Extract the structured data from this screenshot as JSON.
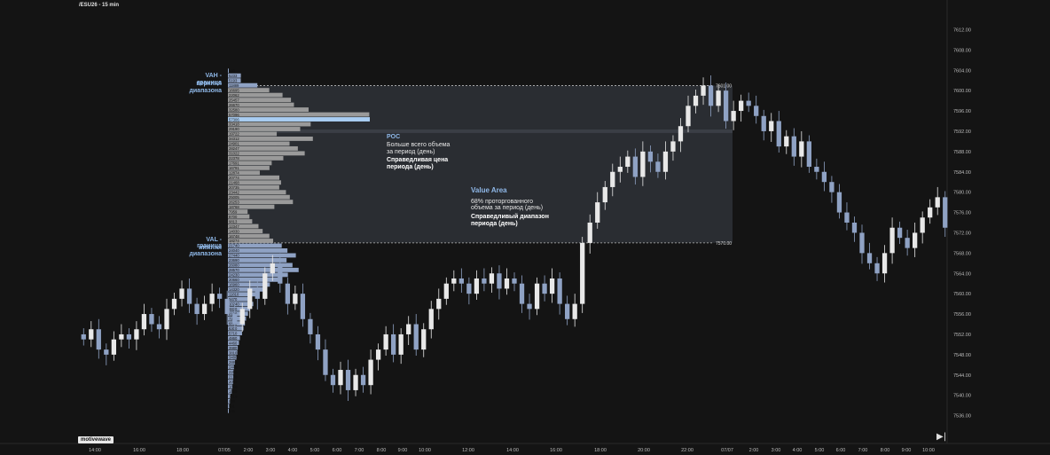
{
  "header": {
    "symbol": "/ESU26 - 15 min"
  },
  "branding": {
    "logo_text": "motivewave"
  },
  "controls": {
    "play_icon_glyph": "▶|"
  },
  "colors": {
    "background": "#141414",
    "up_candle": "#e8e8e8",
    "down_candle": "#8fa2c4",
    "profile_gray": "#9a9a9a",
    "profile_blue": "#8fa2c4",
    "poc_highlight": "#a9cdf2",
    "value_area": "#2a2d32",
    "accent_text": "#8fb8e8"
  },
  "annotations": {
    "vah_line1": "VAH - верхняя",
    "vah_line2": "граница диапазона",
    "val_line1": "VAL - нижняя",
    "val_line2": "граница диапазона",
    "poc_title": "POC",
    "poc_desc1": "Больше всего объема",
    "poc_desc2": "за период (день)",
    "poc_bold1": "Справедливая цена",
    "poc_bold2": "периода (день)",
    "va_title": "Value Area",
    "va_desc1": "68% проторгованного",
    "va_desc2": "объема за период (день)",
    "va_bold1": "Справедливый диапазон",
    "va_bold2": "периода (день)"
  },
  "chart_data": {
    "type": "candlestick",
    "title": "/ESU26 - 15 min",
    "ylim": [
      7534,
      7614
    ],
    "y_ticks": [
      7612,
      7608,
      7604,
      7600,
      7596,
      7592,
      7588,
      7584,
      7580,
      7576,
      7572,
      7568,
      7564,
      7560,
      7556,
      7552,
      7548,
      7544,
      7540,
      7536
    ],
    "y_tick_labels": [
      "7612.00",
      "7608.00",
      "7604.00",
      "7600.00",
      "7596.00",
      "7592.00",
      "7588.00",
      "7584.00",
      "7580.00",
      "7576.00",
      "7572.00",
      "7568.00",
      "7564.00",
      "7560.00",
      "7556.00",
      "7552.00",
      "7548.00",
      "7544.00",
      "7540.00",
      "7536.00"
    ],
    "x_tick_labels": [
      "14:00",
      "16:00",
      "18:00",
      "07/05",
      "2:00",
      "3:00",
      "4:00",
      "5:00",
      "6:00",
      "7:00",
      "8:00",
      "9:00",
      "10:00",
      "12:00",
      "14:00",
      "16:00",
      "18:00",
      "20:00",
      "22:00",
      "07/07",
      "2:00",
      "3:00",
      "4:00",
      "5:00",
      "6:00",
      "7:00",
      "8:00",
      "9:00",
      "10:00"
    ],
    "value_area": {
      "vah": 7601,
      "val": 7570,
      "poc": 7592,
      "vah_label": "7601.00",
      "val_label": "7570.00"
    },
    "closes": [
      7551,
      7553,
      7549,
      7548,
      7551,
      7552,
      7551,
      7553,
      7556,
      7554,
      7553,
      7557,
      7559,
      7561,
      7558,
      7556,
      7558,
      7560,
      7559,
      7556,
      7554,
      7557,
      7561,
      7559,
      7564,
      7566,
      7562,
      7558,
      7560,
      7555,
      7552,
      7549,
      7544,
      7542,
      7545,
      7541,
      7544,
      7542,
      7547,
      7549,
      7552,
      7548,
      7552,
      7554,
      7549,
      7553,
      7557,
      7559,
      7562,
      7563,
      7562,
      7560,
      7563,
      7562,
      7564,
      7561,
      7563,
      7562,
      7558,
      7557,
      7562,
      7560,
      7563,
      7558,
      7555,
      7558,
      7570,
      7574,
      7578,
      7581,
      7584,
      7585,
      7587,
      7583,
      7588,
      7586,
      7584,
      7588,
      7590,
      7593,
      7597,
      7599,
      7601,
      7597,
      7600,
      7594,
      7596,
      7598,
      7597,
      7595,
      7592,
      7594,
      7589,
      7591,
      7587,
      7590,
      7585,
      7584,
      7582,
      7580,
      7576,
      7574,
      7572,
      7568,
      7566,
      7564,
      7568,
      7573,
      7571,
      7569,
      7572,
      7575,
      7577,
      7579,
      7573
    ],
    "profile_volumes": [
      130,
      5233,
      5193,
      11889,
      16695,
      22062,
      25457,
      26670,
      32580,
      57096,
      57306,
      33418,
      29190,
      19722,
      34312,
      24901,
      28247,
      31022,
      22378,
      17691,
      16791,
      12874,
      20774,
      21468,
      20735,
      23442,
      25005,
      26253,
      18768,
      7959,
      8700,
      9813,
      12347,
      14030,
      16748,
      18274,
      21740,
      24040,
      27440,
      23690,
      26080,
      28570,
      24230,
      20660,
      16960,
      14320,
      11810,
      9470,
      10240,
      8830,
      8120,
      7330,
      6880,
      6300,
      5710,
      4860,
      4460,
      3980,
      3810,
      3480,
      2880,
      2440,
      2260,
      2170,
      2090,
      1850,
      1560,
      1010,
      800,
      531,
      345
    ]
  }
}
